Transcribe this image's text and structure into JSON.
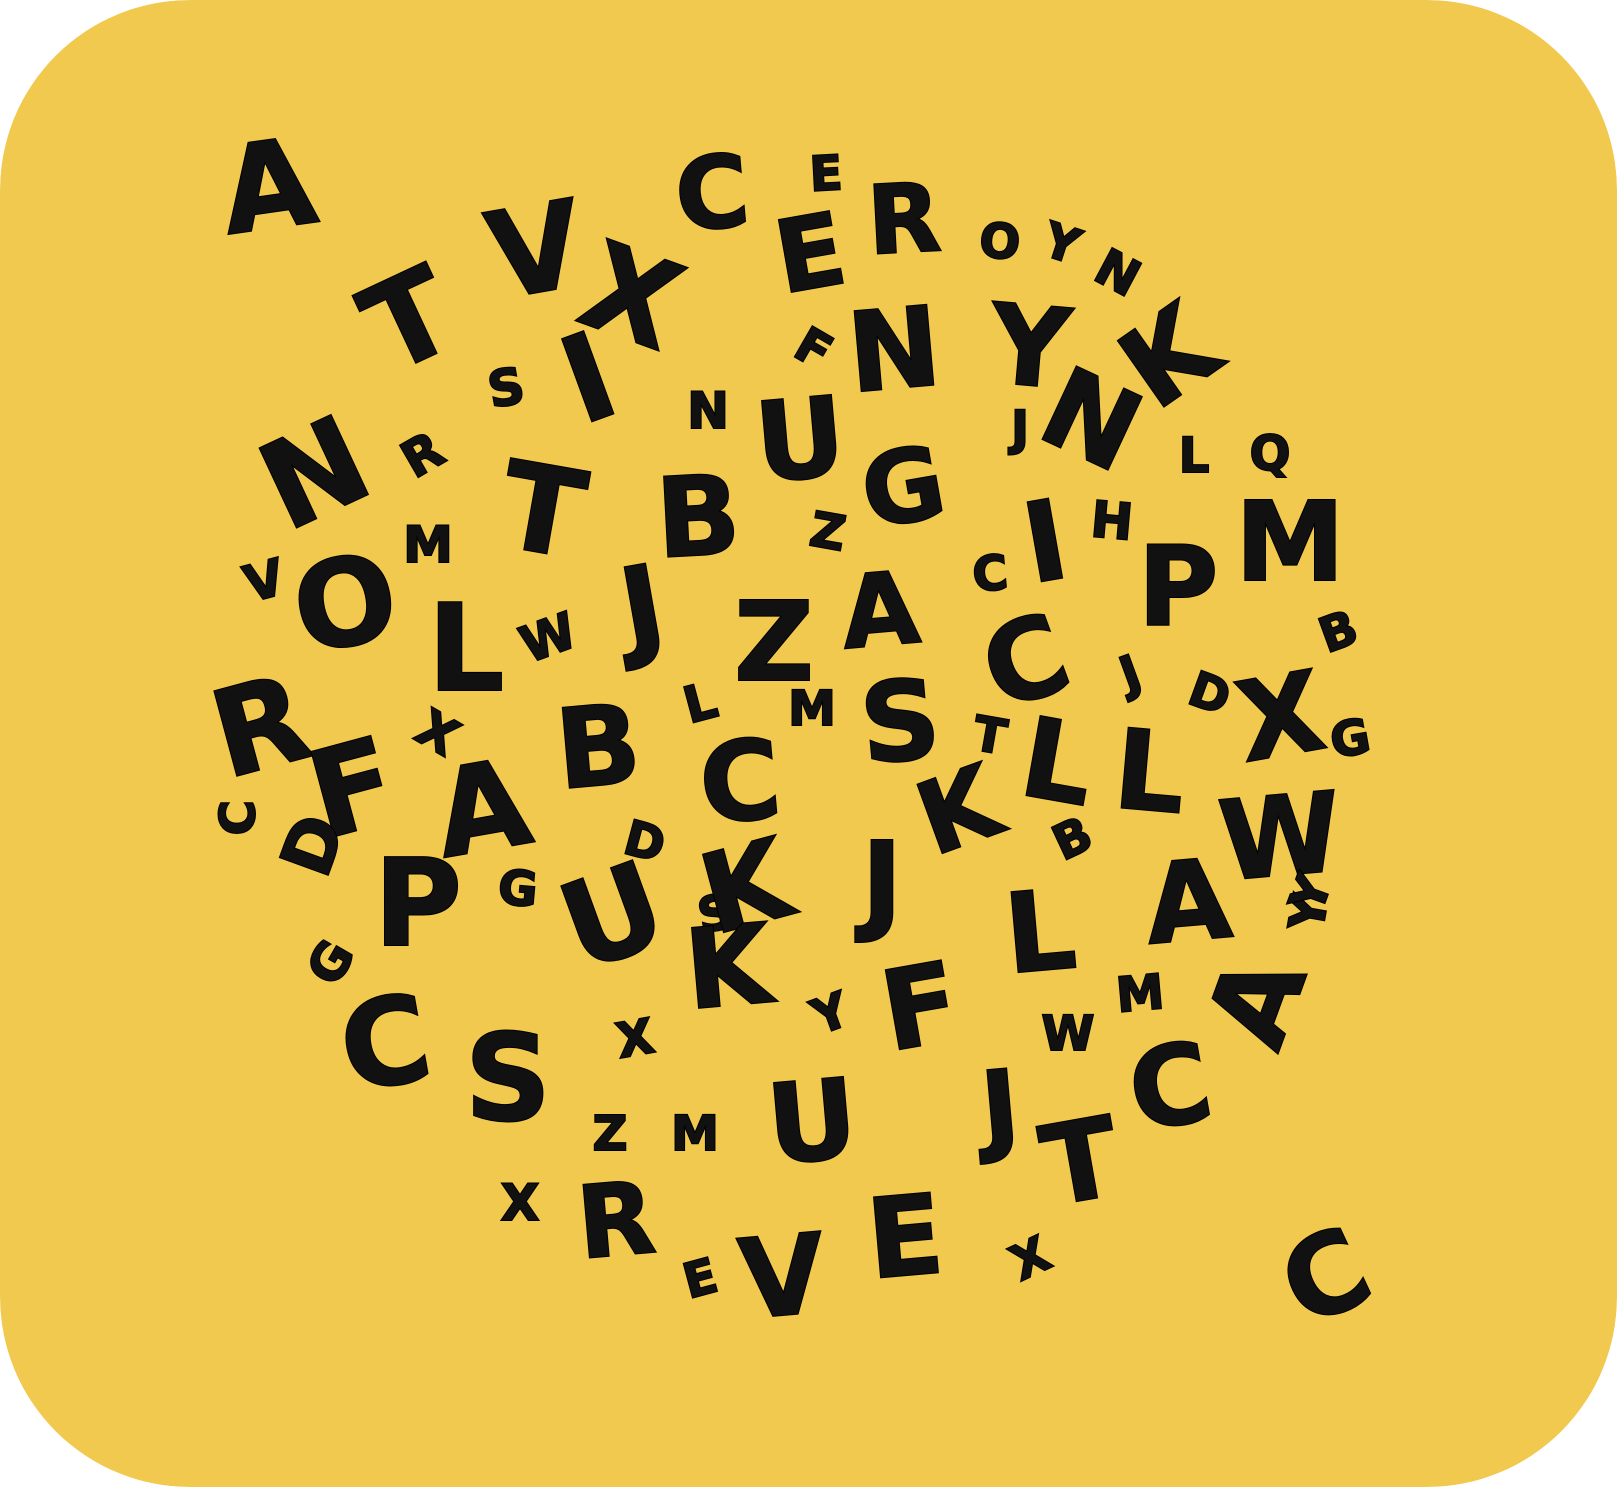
{
  "colors": {
    "background": "#F2C94F",
    "ink": "#111111"
  },
  "letters": [
    "A",
    "C",
    "E",
    "R",
    "O",
    "Y",
    "N",
    "T",
    "V",
    "X",
    "E",
    "N",
    "Y",
    "K",
    "S",
    "I",
    "F",
    "N",
    "R",
    "N",
    "M",
    "T",
    "B",
    "U",
    "G",
    "J",
    "N",
    "L",
    "Q",
    "I",
    "H",
    "P",
    "M",
    "Z",
    "V",
    "O",
    "L",
    "W",
    "J",
    "Z",
    "A",
    "C",
    "B",
    "C",
    "R",
    "L",
    "M",
    "S",
    "J",
    "D",
    "X",
    "G",
    "X",
    "B",
    "T",
    "F",
    "A",
    "C",
    "D",
    "L",
    "K",
    "L",
    "B",
    "W",
    "C",
    "D",
    "P",
    "G",
    "S",
    "U",
    "K",
    "J",
    "L",
    "A",
    "G",
    "K",
    "Y",
    "Y",
    "Y",
    "F",
    "M",
    "C",
    "S",
    "X",
    "W",
    "A",
    "U",
    "Z",
    "M",
    "J",
    "C",
    "T",
    "E",
    "X",
    "R",
    "V",
    "X",
    "E",
    "C",
    "Z"
  ]
}
